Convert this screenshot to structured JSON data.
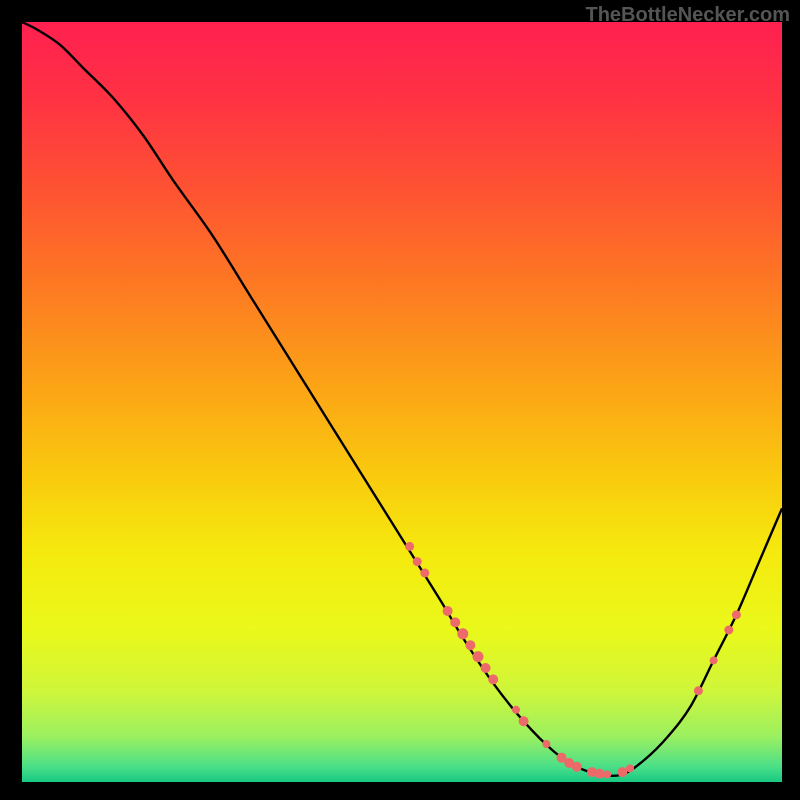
{
  "watermark": "TheBottleNecker.com",
  "chart_data": {
    "type": "line",
    "title": "",
    "xlabel": "",
    "ylabel": "",
    "xlim": [
      0,
      100
    ],
    "ylim": [
      0,
      100
    ],
    "grid": false,
    "background_gradient_stops": [
      {
        "offset": 0.0,
        "color": "#ff2050"
      },
      {
        "offset": 0.1,
        "color": "#ff3244"
      },
      {
        "offset": 0.22,
        "color": "#fe5232"
      },
      {
        "offset": 0.35,
        "color": "#fd7a22"
      },
      {
        "offset": 0.48,
        "color": "#fca416"
      },
      {
        "offset": 0.6,
        "color": "#f9cb0e"
      },
      {
        "offset": 0.7,
        "color": "#f5ea0e"
      },
      {
        "offset": 0.8,
        "color": "#eaf81a"
      },
      {
        "offset": 0.88,
        "color": "#cff63a"
      },
      {
        "offset": 0.94,
        "color": "#9cf060"
      },
      {
        "offset": 0.98,
        "color": "#4adf88"
      },
      {
        "offset": 1.0,
        "color": "#17c983"
      }
    ],
    "series": [
      {
        "name": "bottleneck-curve",
        "color": "#000000",
        "x": [
          0,
          2,
          5,
          8,
          12,
          16,
          20,
          25,
          30,
          35,
          40,
          45,
          50,
          55,
          58,
          62,
          66,
          70,
          73,
          76,
          79,
          82,
          85,
          88,
          91,
          94,
          97,
          100
        ],
        "y": [
          100,
          99,
          97,
          94,
          90,
          85,
          79,
          72,
          64,
          56,
          48,
          40,
          32,
          24,
          19,
          13,
          8,
          4,
          2,
          1,
          1,
          3,
          6,
          10,
          16,
          22,
          29,
          36
        ]
      }
    ],
    "markers": [
      {
        "x": 51,
        "y": 31,
        "r": 4.5
      },
      {
        "x": 52,
        "y": 29,
        "r": 4.5
      },
      {
        "x": 53,
        "y": 27.5,
        "r": 4.5
      },
      {
        "x": 56,
        "y": 22.5,
        "r": 5
      },
      {
        "x": 57,
        "y": 21,
        "r": 5
      },
      {
        "x": 58,
        "y": 19.5,
        "r": 5.5
      },
      {
        "x": 59,
        "y": 18,
        "r": 5
      },
      {
        "x": 60,
        "y": 16.5,
        "r": 5.5
      },
      {
        "x": 61,
        "y": 15,
        "r": 5
      },
      {
        "x": 62,
        "y": 13.5,
        "r": 5
      },
      {
        "x": 65,
        "y": 9.5,
        "r": 4
      },
      {
        "x": 66,
        "y": 8,
        "r": 5
      },
      {
        "x": 69,
        "y": 5,
        "r": 4
      },
      {
        "x": 71,
        "y": 3.2,
        "r": 5
      },
      {
        "x": 72,
        "y": 2.5,
        "r": 5
      },
      {
        "x": 73,
        "y": 2,
        "r": 5
      },
      {
        "x": 75,
        "y": 1.3,
        "r": 5
      },
      {
        "x": 76,
        "y": 1.1,
        "r": 5
      },
      {
        "x": 77,
        "y": 1,
        "r": 4
      },
      {
        "x": 79,
        "y": 1.3,
        "r": 5
      },
      {
        "x": 80,
        "y": 1.8,
        "r": 4
      },
      {
        "x": 89,
        "y": 12,
        "r": 4.5
      },
      {
        "x": 91,
        "y": 16,
        "r": 4
      },
      {
        "x": 93,
        "y": 20,
        "r": 4.5
      },
      {
        "x": 94,
        "y": 22,
        "r": 4.5
      }
    ],
    "marker_color": "#ec6a6a"
  }
}
